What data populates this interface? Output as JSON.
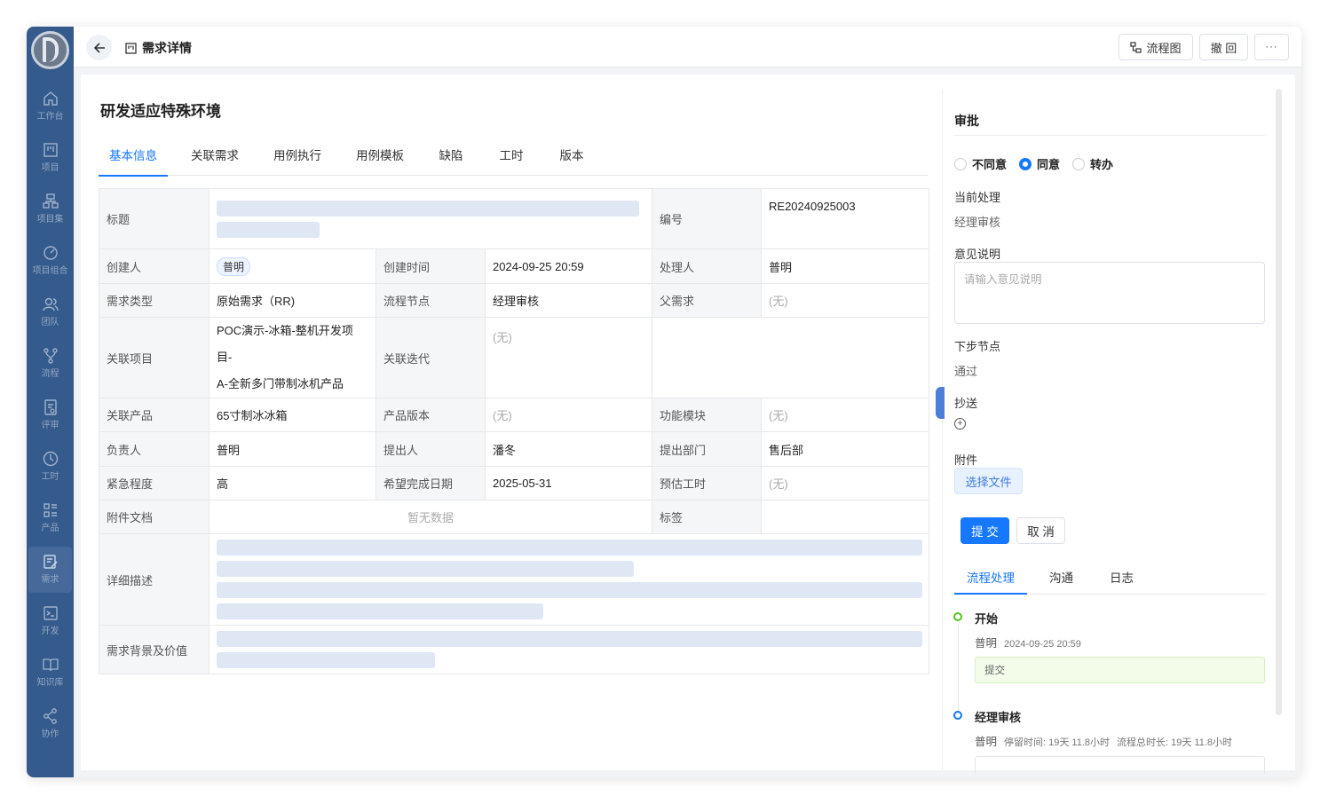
{
  "header": {
    "page_title": "需求详情",
    "flow_label": "流程图",
    "revoke_label": "撤 回",
    "more_label": "···"
  },
  "sidebar": {
    "items": [
      {
        "label": "工作台",
        "icon": "home-icon"
      },
      {
        "label": "项目",
        "icon": "project-icon"
      },
      {
        "label": "项目集",
        "icon": "project-set-icon"
      },
      {
        "label": "项目组合",
        "icon": "portfolio-icon"
      },
      {
        "label": "团队",
        "icon": "team-icon"
      },
      {
        "label": "流程",
        "icon": "flow-icon"
      },
      {
        "label": "评审",
        "icon": "review-icon"
      },
      {
        "label": "工时",
        "icon": "clock-icon"
      },
      {
        "label": "产品",
        "icon": "product-icon"
      },
      {
        "label": "需求",
        "icon": "requirement-icon",
        "active": true
      },
      {
        "label": "开发",
        "icon": "terminal-icon"
      },
      {
        "label": "知识库",
        "icon": "book-icon"
      },
      {
        "label": "协作",
        "icon": "share-icon"
      }
    ]
  },
  "main": {
    "title": "研发适应特殊环境",
    "tabs": [
      "基本信息",
      "关联需求",
      "用例执行",
      "用例模板",
      "缺陷",
      "工时",
      "版本"
    ],
    "fields": {
      "title_label": "标题",
      "number_label": "编号",
      "number_value": "RE20240925003",
      "creator_label": "创建人",
      "creator_value": "普明",
      "created_label": "创建时间",
      "created_value": "2024-09-25 20:59",
      "handler_label": "处理人",
      "handler_value": "普明",
      "type_label": "需求类型",
      "type_value": "原始需求（RR)",
      "node_label": "流程节点",
      "node_value": "经理审核",
      "parent_label": "父需求",
      "parent_value": "(无)",
      "project_label": "关联项目",
      "project_value_line1": "POC演示-冰箱-整机开发项目-",
      "project_value_line2": "A-全新多门带制冰机产品",
      "iteration_label": "关联迭代",
      "iteration_value": "(无)",
      "product_label": "关联产品",
      "product_value": "65寸制冰冰箱",
      "version_label": "产品版本",
      "version_value": "(无)",
      "module_label": "功能模块",
      "module_value": "(无)",
      "owner_label": "负责人",
      "owner_value": "普明",
      "proposer_label": "提出人",
      "proposer_value": "潘冬",
      "dept_label": "提出部门",
      "dept_value": "售后部",
      "urgency_label": "紧急程度",
      "urgency_value": "高",
      "due_label": "希望完成日期",
      "due_value": "2025-05-31",
      "estimate_label": "预估工时",
      "estimate_value": "(无)",
      "attach_label": "附件文档",
      "attach_value": "暂无数据",
      "tag_label": "标签",
      "desc_label": "详细描述",
      "background_label": "需求背景及价值"
    }
  },
  "panel": {
    "title": "审批",
    "options": [
      "不同意",
      "同意",
      "转办"
    ],
    "selected": "同意",
    "current_label": "当前处理",
    "current_value": "经理审核",
    "comment_label": "意见说明",
    "comment_placeholder": "请输入意见说明",
    "next_label": "下步节点",
    "next_value": "通过",
    "cc_label": "抄送",
    "attach_label": "附件",
    "file_btn": "选择文件",
    "submit": "提 交",
    "cancel": "取 消",
    "tabs": [
      "流程处理",
      "沟通",
      "日志"
    ],
    "timeline": [
      {
        "title": "开始",
        "user": "普明",
        "time": "2024-09-25 20:59",
        "note": "提交"
      },
      {
        "title": "经理审核",
        "user": "普明",
        "stay_label": "停留时间:",
        "stay_value": "19天 11.8小时",
        "total_label": "流程总时长:",
        "total_value": "19天 11.8小时"
      }
    ]
  },
  "colors": {
    "accent": "#1677ff",
    "sidebar": "#355a8c",
    "skeleton": "#dfe7f5",
    "timeline_start": "#52c41a"
  }
}
